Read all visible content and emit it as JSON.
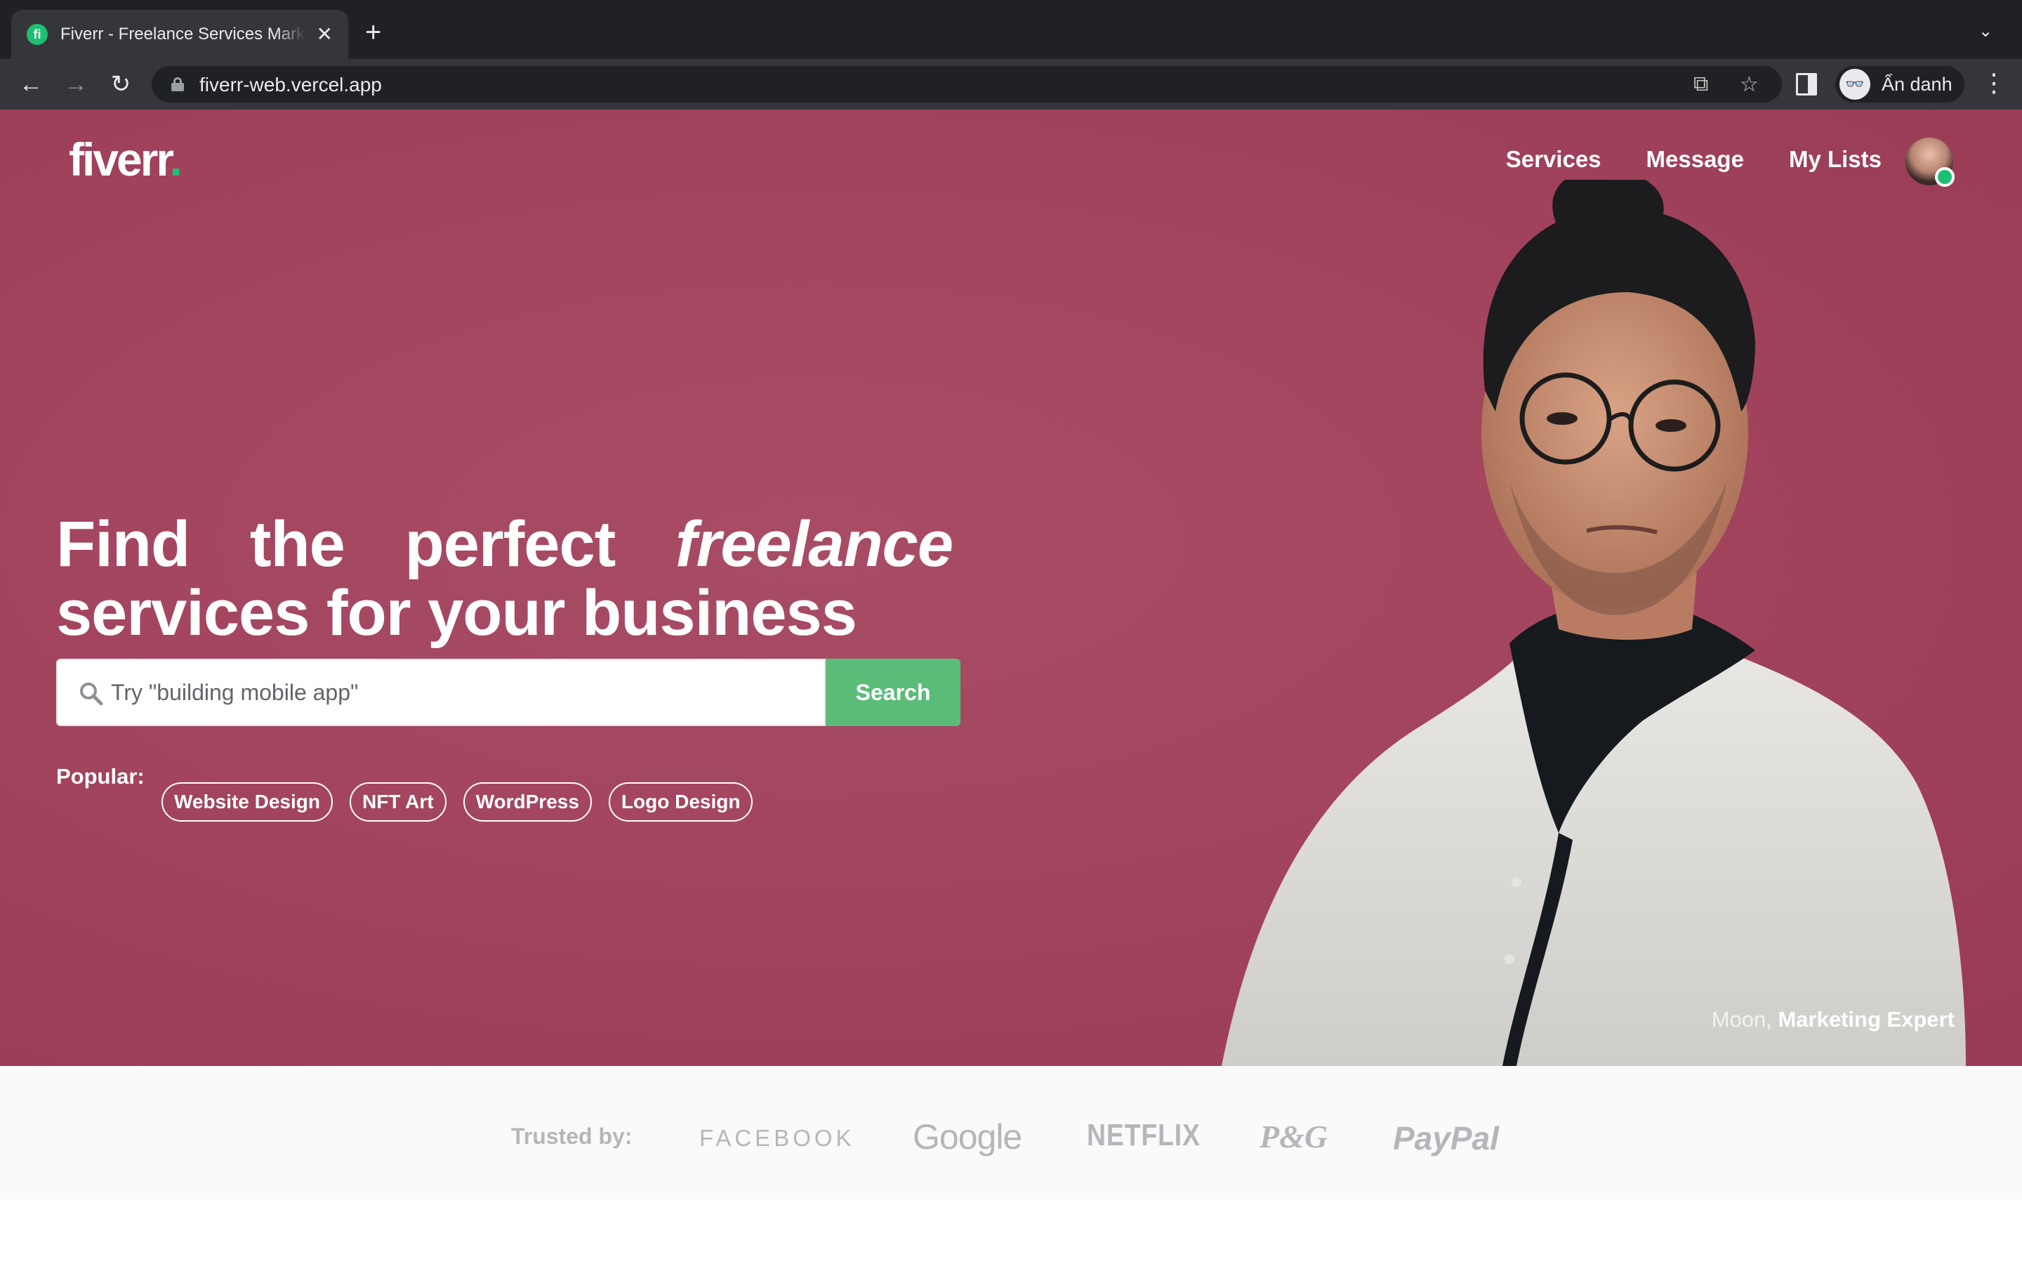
{
  "browser": {
    "tab_title": "Fiverr - Freelance Services Marketplace",
    "favicon_text": "fi",
    "url": "fiverr-web.vercel.app",
    "profile_label": "Ẩn danh"
  },
  "header": {
    "logo_text": "fiverr",
    "logo_dot": ".",
    "nav": [
      {
        "label": "Services"
      },
      {
        "label": "Message"
      },
      {
        "label": "My Lists"
      }
    ]
  },
  "hero": {
    "headline_words_line1": [
      "Find",
      "the",
      "perfect",
      "freelance"
    ],
    "headline_line2": "services for your business",
    "search_placeholder": "Try \"building mobile app\"",
    "search_button": "Search",
    "popular_label": "Popular:",
    "popular_tags": [
      "Website Design",
      "NFT Art",
      "WordPress",
      "Logo Design"
    ],
    "caption_name": "Moon,",
    "caption_role": "Marketing Expert",
    "background_color": "#a3455f"
  },
  "trusted": {
    "label": "Trusted by:",
    "brands": [
      "FACEBOOK",
      "Google",
      "NETFLIX",
      "P&G",
      "PayPal"
    ]
  },
  "colors": {
    "accent": "#1dbf73",
    "search_button": "#5bbc7a",
    "hero_bg": "#a3455f"
  }
}
